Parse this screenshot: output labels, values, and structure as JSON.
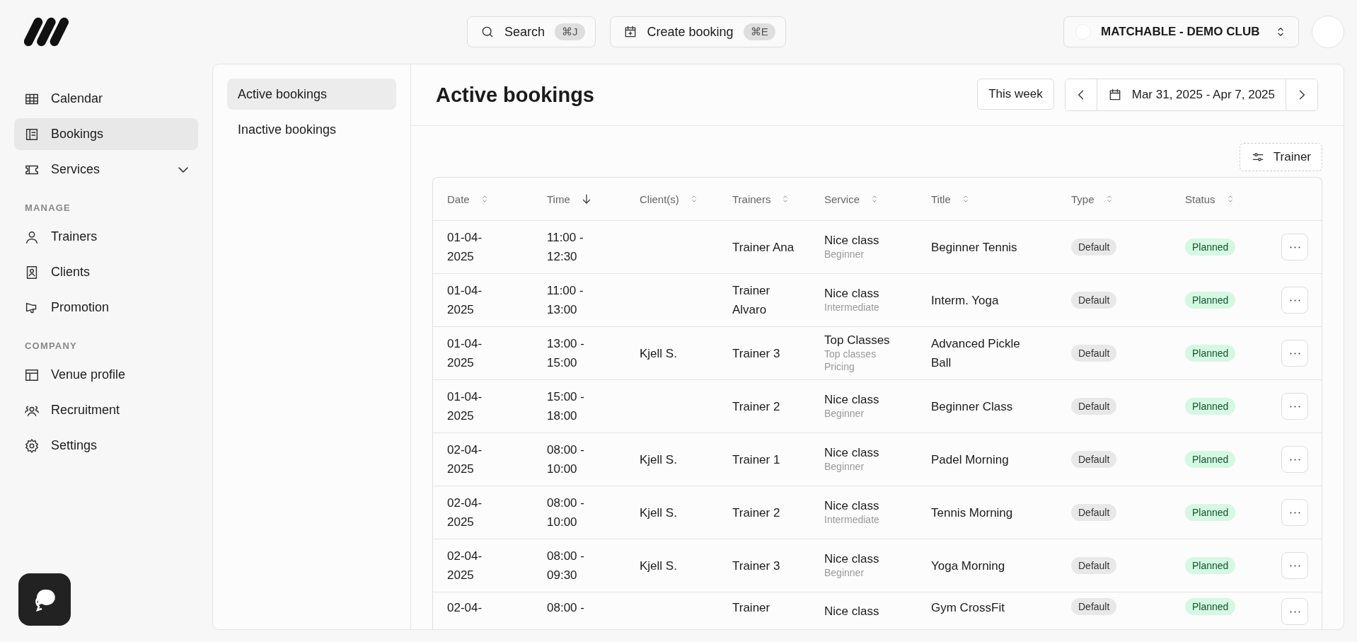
{
  "topbar": {
    "search": {
      "label": "Search",
      "shortcut": "⌘J"
    },
    "create": {
      "label": "Create booking",
      "shortcut": "⌘E"
    },
    "club": {
      "name": "MATCHABLE - DEMO CLUB"
    }
  },
  "sidebar": {
    "sections": [
      {
        "items": [
          {
            "label": "Calendar",
            "selected": false
          },
          {
            "label": "Bookings",
            "selected": true
          },
          {
            "label": "Services",
            "selected": false,
            "submenu": true
          }
        ]
      },
      {
        "label": "MANAGE",
        "items": [
          {
            "label": "Trainers",
            "selected": false
          },
          {
            "label": "Clients",
            "selected": false
          },
          {
            "label": "Promotion",
            "selected": false
          }
        ]
      },
      {
        "label": "COMPANY",
        "items": [
          {
            "label": "Venue profile",
            "selected": false
          },
          {
            "label": "Recruitment",
            "selected": false
          },
          {
            "label": "Settings",
            "selected": false
          }
        ]
      }
    ]
  },
  "subnav": [
    {
      "label": "Active bookings",
      "selected": true
    },
    {
      "label": "Inactive bookings",
      "selected": false
    }
  ],
  "page": {
    "title": "Active bookings",
    "this_week": "This week",
    "date_range": "Mar 31, 2025 - Apr 7, 2025",
    "filter": "Trainer"
  },
  "table": {
    "columns": [
      {
        "label": "Date",
        "sorted": false
      },
      {
        "label": "Time",
        "sorted": true
      },
      {
        "label": "Client(s)",
        "sorted": false
      },
      {
        "label": "Trainers",
        "sorted": false
      },
      {
        "label": "Service",
        "sorted": false
      },
      {
        "label": "Title",
        "sorted": false
      },
      {
        "label": "Type",
        "sorted": false
      },
      {
        "label": "Status",
        "sorted": false
      }
    ],
    "rows": [
      {
        "date": "01-04-2025",
        "time": "11:00 - 12:30",
        "client": "",
        "trainer": "Trainer Ana",
        "service": "Nice class",
        "service_detail": "Beginner",
        "title": "Beginner Tennis",
        "type": "Default",
        "status": "Planned"
      },
      {
        "date": "01-04-2025",
        "time": "11:00 - 13:00",
        "client": "",
        "trainer": "Trainer Alvaro",
        "service": "Nice class",
        "service_detail": "Intermediate",
        "title": "Interm. Yoga",
        "type": "Default",
        "status": "Planned"
      },
      {
        "date": "01-04-2025",
        "time": "13:00 - 15:00",
        "client": "Kjell S.",
        "trainer": "Trainer 3",
        "service": "Top Classes",
        "service_detail": "Top classes Pricing",
        "title": "Advanced Pickle Ball",
        "type": "Default",
        "status": "Planned"
      },
      {
        "date": "01-04-2025",
        "time": "15:00 - 18:00",
        "client": "",
        "trainer": "Trainer 2",
        "service": "Nice class",
        "service_detail": "Beginner",
        "title": "Beginner Class",
        "type": "Default",
        "status": "Planned"
      },
      {
        "date": "02-04-2025",
        "time": "08:00 - 10:00",
        "client": "Kjell S.",
        "trainer": "Trainer 1",
        "service": "Nice class",
        "service_detail": "Beginner",
        "title": "Padel Morning",
        "type": "Default",
        "status": "Planned"
      },
      {
        "date": "02-04-2025",
        "time": "08:00 - 10:00",
        "client": "Kjell S.",
        "trainer": "Trainer 2",
        "service": "Nice class",
        "service_detail": "Intermediate",
        "title": "Tennis Morning",
        "type": "Default",
        "status": "Planned"
      },
      {
        "date": "02-04-2025",
        "time": "08:00 - 09:30",
        "client": "Kjell S.",
        "trainer": "Trainer 3",
        "service": "Nice class",
        "service_detail": "Beginner",
        "title": "Yoga Morning",
        "type": "Default",
        "status": "Planned"
      },
      {
        "date": "02-04-",
        "time": "08:00 -",
        "client": "",
        "trainer": "Trainer",
        "service": "Nice class",
        "service_detail": "",
        "title": "Gym CrossFit",
        "type": "Default",
        "status": "Planned"
      }
    ]
  }
}
